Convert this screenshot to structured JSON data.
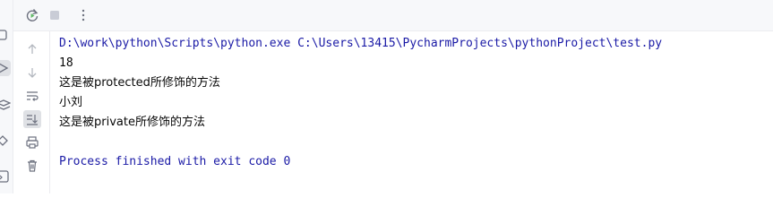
{
  "toolbar": {
    "icons": [
      "rerun-icon",
      "stop-icon",
      "more-options-icon"
    ]
  },
  "side_toolbar": {
    "icons": [
      "scroll-up-icon",
      "scroll-down-icon",
      "soft-wrap-icon",
      "scroll-to-end-icon",
      "print-icon",
      "clear-icon"
    ]
  },
  "left_strip": {
    "icons": [
      "plugin-icon",
      "run-icon",
      "layers-icon",
      "services-icon",
      "terminal-icon"
    ]
  },
  "console": {
    "command": "D:\\work\\python\\Scripts\\python.exe C:\\Users\\13415\\PycharmProjects\\pythonProject\\test.py",
    "output": [
      "18",
      "这是被protected所修饰的方法",
      "小刘",
      "这是被private所修饰的方法"
    ],
    "blank": "",
    "exit_message": "Process finished with exit code 0"
  },
  "colors": {
    "command": "#1a1aa6",
    "exit": "#1a1aa6",
    "text": "#080808",
    "rerun_green": "#5fb865",
    "panel_bg": "#f7f8fa"
  }
}
